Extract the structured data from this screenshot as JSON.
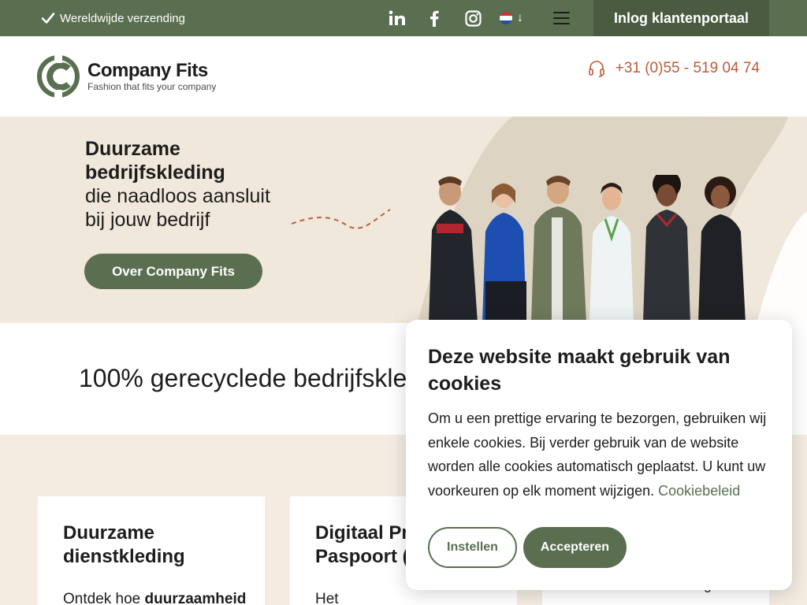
{
  "topbar": {
    "shipping": "Wereldwijde verzending",
    "login": "Inlog klantenportaal",
    "lang_arrow": "↓",
    "icons": [
      "linkedin-icon",
      "facebook-icon",
      "instagram-icon",
      "netherlands-flag-icon",
      "menu-icon"
    ]
  },
  "header": {
    "brand_name": "Company Fits",
    "brand_tagline": "Fashion that fits your company",
    "phone": "+31 (0)55 - 519 04 74"
  },
  "hero": {
    "title_line1": "Duurzame",
    "title_line2": "bedrijfskleding",
    "sub_line1": "die naadloos aansluit",
    "sub_line2": "bij jouw bedrijf",
    "button": "Over Company Fits"
  },
  "band": {
    "heading": "100% gerecyclede bedrijfskled"
  },
  "cards": [
    {
      "title_line1": "Duurzame",
      "title_line2": "dienstkleding",
      "text_plain": "Ontdek hoe ",
      "text_bold": "duurzaamheid"
    },
    {
      "title_line1": "Digitaal Pr",
      "title_line2": "Paspoort (",
      "text_plain": "Het",
      "text_bold": ""
    }
  ],
  "peek_text": "en levering",
  "cookie": {
    "title": "Deze website maakt gebruik van cookies",
    "text": "Om u een prettige ervaring te bezorgen, gebruiken wij enkele cookies. Bij verder gebruik van de website worden alle cookies automatisch geplaatst. U kunt uw voorkeuren op elk moment wijzigen.",
    "link": "Cookiebeleid",
    "btn_settings": "Instellen",
    "btn_accept": "Accepteren"
  },
  "colors": {
    "primary_green": "#5a6f4f",
    "accent_orange": "#c05a37",
    "hero_bg": "#f1e8dc"
  }
}
